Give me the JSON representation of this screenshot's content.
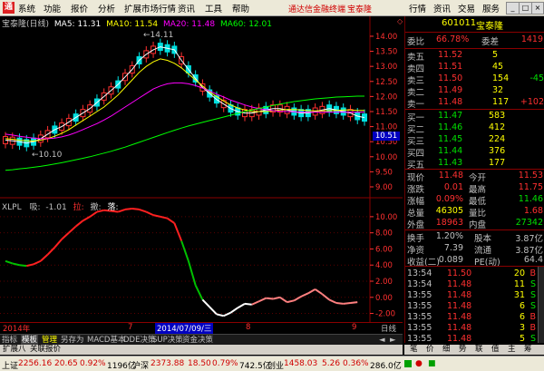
{
  "menu": {
    "items": [
      "系统",
      "功能",
      "报价",
      "分析",
      "扩展市场行情",
      "资讯",
      "工具",
      "帮助"
    ],
    "hot1": "通达信金融终端",
    "hot2": "宝泰隆",
    "right": [
      "行情",
      "资讯",
      "交易",
      "服务"
    ]
  },
  "main_chart": {
    "stock_label": "宝泰隆(日线)",
    "ma5": "MA5: 11.31",
    "ma10": "MA10: 11.54",
    "ma20": "MA20: 11.48",
    "ma60": "MA60: 12.01",
    "high_note": "14.11",
    "low_note": "10.10",
    "price_tag": "10.51",
    "yticks": [
      "14.00",
      "13.50",
      "13.00",
      "12.50",
      "12.00",
      "11.50",
      "11.00",
      "10.50",
      "10.00",
      "9.50",
      "9.00"
    ]
  },
  "sub_chart": {
    "label": "XLPL",
    "item1": "吸:",
    "val1": "-1.01",
    "item2": "拉:",
    "item3": "撤:",
    "item4": "落:",
    "yticks": [
      "10.00",
      "8.00",
      "6.00",
      "4.00",
      "2.00",
      "0.00",
      "-2.00"
    ]
  },
  "time_axis": {
    "left_label": "2014年",
    "mark7": "7",
    "date_box": "2014/07/09/三",
    "mark8": "8",
    "mark9": "9",
    "period": "日线"
  },
  "chart_data": {
    "type": "line",
    "title": "宝泰隆(日线)",
    "xlabel": "",
    "ylabel": "",
    "ylim": [
      9.0,
      14.3
    ],
    "x_labels": [
      "2014年",
      "7",
      "8",
      "9"
    ],
    "series": [
      {
        "name": "MA5",
        "color": "#ffffff",
        "values": [
          10.55,
          10.53,
          10.5,
          10.45,
          10.5,
          10.6,
          10.75,
          10.9,
          11.0,
          11.15,
          11.3,
          11.45,
          11.6,
          11.8,
          12.0,
          12.2,
          12.4,
          12.65,
          12.9,
          13.2,
          13.4,
          13.55,
          13.65,
          13.6,
          13.55,
          13.2,
          12.9,
          12.6,
          12.3,
          12.1,
          11.9,
          11.75,
          11.6,
          11.5,
          11.45,
          11.45,
          11.5,
          11.55,
          11.6,
          11.6,
          11.55,
          11.5,
          11.45,
          11.45,
          11.5,
          11.55,
          11.6,
          11.55,
          11.5,
          11.45,
          11.35,
          11.3
        ]
      },
      {
        "name": "MA10",
        "color": "#ffff00",
        "values": [
          10.6,
          10.58,
          10.55,
          10.53,
          10.52,
          10.55,
          10.6,
          10.68,
          10.78,
          10.9,
          11.05,
          11.2,
          11.35,
          11.5,
          11.65,
          11.85,
          12.05,
          12.3,
          12.55,
          12.8,
          13.0,
          13.15,
          13.25,
          13.2,
          13.1,
          12.95,
          12.75,
          12.55,
          12.35,
          12.15,
          12.0,
          11.85,
          11.72,
          11.62,
          11.55,
          11.5,
          11.5,
          11.5,
          11.52,
          11.55,
          11.57,
          11.57,
          11.55,
          11.53,
          11.52,
          11.52,
          11.53,
          11.54,
          11.55,
          11.55,
          11.54,
          11.54
        ]
      },
      {
        "name": "MA20",
        "color": "#ff00ff",
        "values": [
          10.75,
          10.72,
          10.68,
          10.65,
          10.62,
          10.6,
          10.6,
          10.62,
          10.66,
          10.72,
          10.8,
          10.9,
          11.0,
          11.1,
          11.22,
          11.35,
          11.5,
          11.65,
          11.8,
          11.95,
          12.1,
          12.25,
          12.35,
          12.42,
          12.45,
          12.45,
          12.42,
          12.36,
          12.28,
          12.18,
          12.08,
          11.98,
          11.88,
          11.8,
          11.72,
          11.65,
          11.6,
          11.56,
          11.53,
          11.51,
          11.5,
          11.49,
          11.48,
          11.48,
          11.48,
          11.48,
          11.48,
          11.48,
          11.48,
          11.48,
          11.48,
          11.48
        ]
      },
      {
        "name": "MA60",
        "color": "#00ff00",
        "values": [
          9.55,
          9.57,
          9.6,
          9.62,
          9.65,
          9.68,
          9.72,
          9.76,
          9.8,
          9.85,
          9.9,
          9.95,
          10.0,
          10.06,
          10.12,
          10.18,
          10.25,
          10.32,
          10.4,
          10.48,
          10.56,
          10.64,
          10.72,
          10.8,
          10.88,
          10.95,
          11.02,
          11.08,
          11.14,
          11.2,
          11.26,
          11.32,
          11.38,
          11.44,
          11.5,
          11.55,
          11.6,
          11.65,
          11.7,
          11.75,
          11.79,
          11.83,
          11.86,
          11.89,
          11.92,
          11.94,
          11.96,
          11.98,
          11.99,
          12.0,
          12.01,
          12.01
        ]
      }
    ],
    "oscillator": {
      "name": "XLPL",
      "ylim": [
        -2.5,
        11
      ],
      "values": [
        4.5,
        4.2,
        4.0,
        3.9,
        4.1,
        4.5,
        5.3,
        6.2,
        7.2,
        8.0,
        8.8,
        9.5,
        10.0,
        10.6,
        10.8,
        10.7,
        10.6,
        10.9,
        11.0,
        10.9,
        10.6,
        10.2,
        10.0,
        9.8,
        9.2,
        7.0,
        4.5,
        1.5,
        -0.3,
        -1.2,
        -2.1,
        -2.3,
        -1.9,
        -1.3,
        -0.8,
        -0.9,
        -0.5,
        -0.1,
        -0.2,
        0.0,
        -0.6,
        -0.4,
        0.1,
        0.5,
        1.0,
        0.4,
        -0.3,
        -0.7,
        -0.8,
        -0.7,
        -0.6
      ]
    }
  },
  "quote": {
    "code": "601011",
    "name": "宝泰隆",
    "weibi_label": "委比",
    "weibi": "66.78%",
    "weicha_label": "委差",
    "weicha": "1419",
    "sells": [
      {
        "label": "卖五",
        "price": "11.52",
        "vol": "5",
        "chg": ""
      },
      {
        "label": "卖四",
        "price": "11.51",
        "vol": "45",
        "chg": ""
      },
      {
        "label": "卖三",
        "price": "11.50",
        "vol": "154",
        "chg": "-45"
      },
      {
        "label": "卖二",
        "price": "11.49",
        "vol": "32",
        "chg": ""
      },
      {
        "label": "卖一",
        "price": "11.48",
        "vol": "117",
        "chg": "+102"
      }
    ],
    "buys": [
      {
        "label": "买一",
        "price": "11.47",
        "vol": "583"
      },
      {
        "label": "买二",
        "price": "11.46",
        "vol": "412"
      },
      {
        "label": "买三",
        "price": "11.45",
        "vol": "224"
      },
      {
        "label": "买四",
        "price": "11.44",
        "vol": "376"
      },
      {
        "label": "买五",
        "price": "11.43",
        "vol": "177"
      }
    ],
    "stats": [
      {
        "l1": "现价",
        "v1": "11.48",
        "l2": "今开",
        "v2": "11.53"
      },
      {
        "l1": "涨跌",
        "v1": "0.01",
        "l2": "最高",
        "v2": "11.75"
      },
      {
        "l1": "涨幅",
        "v1": "0.09%",
        "l2": "最低",
        "v2": "11.46"
      },
      {
        "l1": "总量",
        "v1": "46305",
        "l2": "量比",
        "v2": "1.68"
      },
      {
        "l1": "外盘",
        "v1": "18963",
        "l2": "内盘",
        "v2": "27342"
      }
    ],
    "stats2": [
      {
        "l1": "换手",
        "v1": "1.20%",
        "l2": "股本",
        "v2": "3.87亿"
      },
      {
        "l1": "净资",
        "v1": "7.39",
        "l2": "流通",
        "v2": "3.87亿"
      },
      {
        "l1": "收益(二)",
        "v1": "0.089",
        "l2": "PE(动)",
        "v2": "64.4"
      }
    ],
    "ticks": [
      {
        "time": "13:54",
        "price": "11.50",
        "vol": "20",
        "side": "B"
      },
      {
        "time": "13:54",
        "price": "11.48",
        "vol": "11",
        "side": "S"
      },
      {
        "time": "13:55",
        "price": "11.48",
        "vol": "31",
        "side": "S"
      },
      {
        "time": "13:55",
        "price": "11.48",
        "vol": "6",
        "side": "S"
      },
      {
        "time": "13:55",
        "price": "11.48",
        "vol": "6",
        "side": "B"
      },
      {
        "time": "13:55",
        "price": "11.48",
        "vol": "3",
        "side": "B"
      },
      {
        "time": "13:55",
        "price": "11.48",
        "vol": "5",
        "side": "S"
      }
    ]
  },
  "tabs": [
    "指标",
    "模板",
    "管理",
    "另存为",
    "MACD基本",
    "DDE决策",
    "SUP决策",
    "资金决策"
  ],
  "ext": [
    "扩展八",
    "关联报价"
  ],
  "rtabs": [
    "笔",
    "价",
    "细",
    "势",
    "联",
    "值",
    "主",
    "筹"
  ],
  "status": {
    "sh_label": "上证",
    "sh_val": "2256.16",
    "sh_chg": "20.65",
    "sh_pct": "0.92%",
    "sh_amt": "1196亿",
    "sz_label": "沪深",
    "sz_val": "2373.88",
    "sz_chg": "18.50",
    "sz_pct": "0.79%",
    "sz_amt": "742.5亿",
    "cy_label": "创业",
    "cy_val": "1458.03",
    "cy_chg": "5.26",
    "cy_pct": "0.36%",
    "cy_amt": "286.0亿"
  }
}
